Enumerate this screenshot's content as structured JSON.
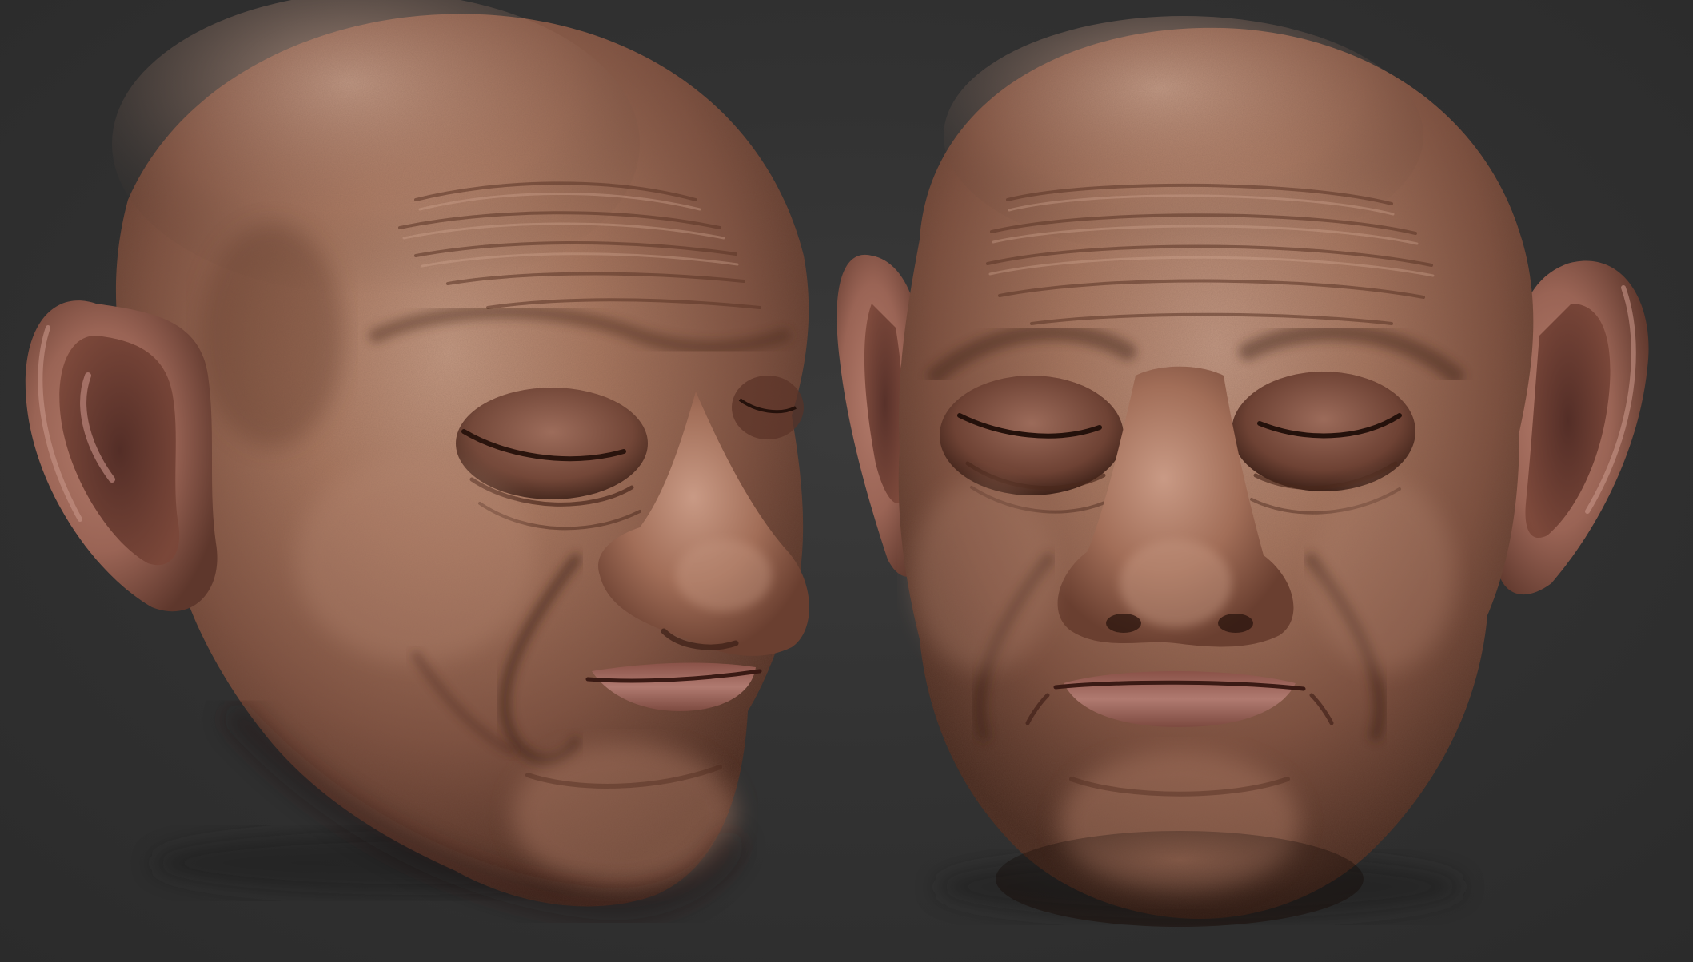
{
  "scene": {
    "background_color": "#303030",
    "skin_base_color": "#9b6b55",
    "skin_shadow_color": "#5a3628",
    "skin_highlight_color": "#c9a088",
    "lip_color": "#a8706a",
    "models": [
      {
        "view": "three-quarter"
      },
      {
        "view": "front"
      }
    ]
  }
}
